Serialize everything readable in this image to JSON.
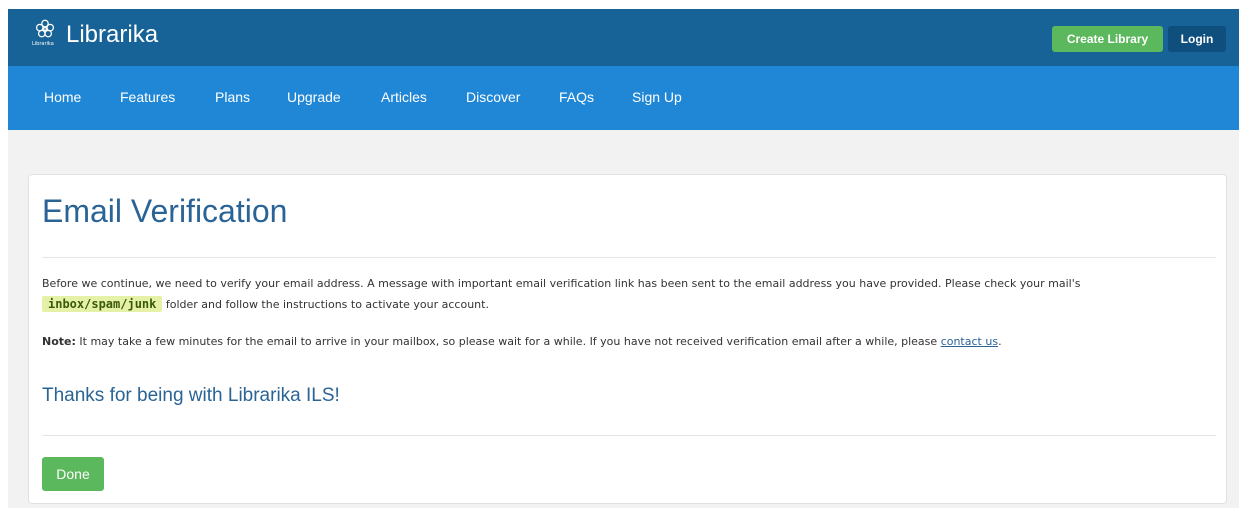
{
  "header": {
    "logo_icon": "flower-icon",
    "logo_caption": "Librarika",
    "brand": "Librarika",
    "create_library_label": "Create Library",
    "login_label": "Login",
    "colors": {
      "topbar": "#176296",
      "navbar": "#1f87d6",
      "green": "#5cb85c"
    }
  },
  "nav": {
    "items": [
      {
        "label": "Home"
      },
      {
        "label": "Features"
      },
      {
        "label": "Plans"
      },
      {
        "label": "Upgrade"
      },
      {
        "label": "Articles"
      },
      {
        "label": "Discover"
      },
      {
        "label": "FAQs"
      },
      {
        "label": "Sign Up"
      }
    ]
  },
  "main": {
    "title": "Email Verification",
    "paragraph1_before": "Before we continue, we need to verify your email address. A message with important email verification link has been sent to the email address you have provided. Please check your mail's",
    "paragraph1_highlight": "inbox/spam/junk",
    "paragraph1_after": "folder and follow the instructions to activate your account.",
    "note_label": "Note:",
    "note_text": "It may take a few minutes for the email to arrive in your mailbox, so please wait for a while. If you have not received verification email after a while, please",
    "note_link": "contact us",
    "note_end": ".",
    "thanks": "Thanks for being with Librarika ILS!",
    "done_label": "Done"
  }
}
